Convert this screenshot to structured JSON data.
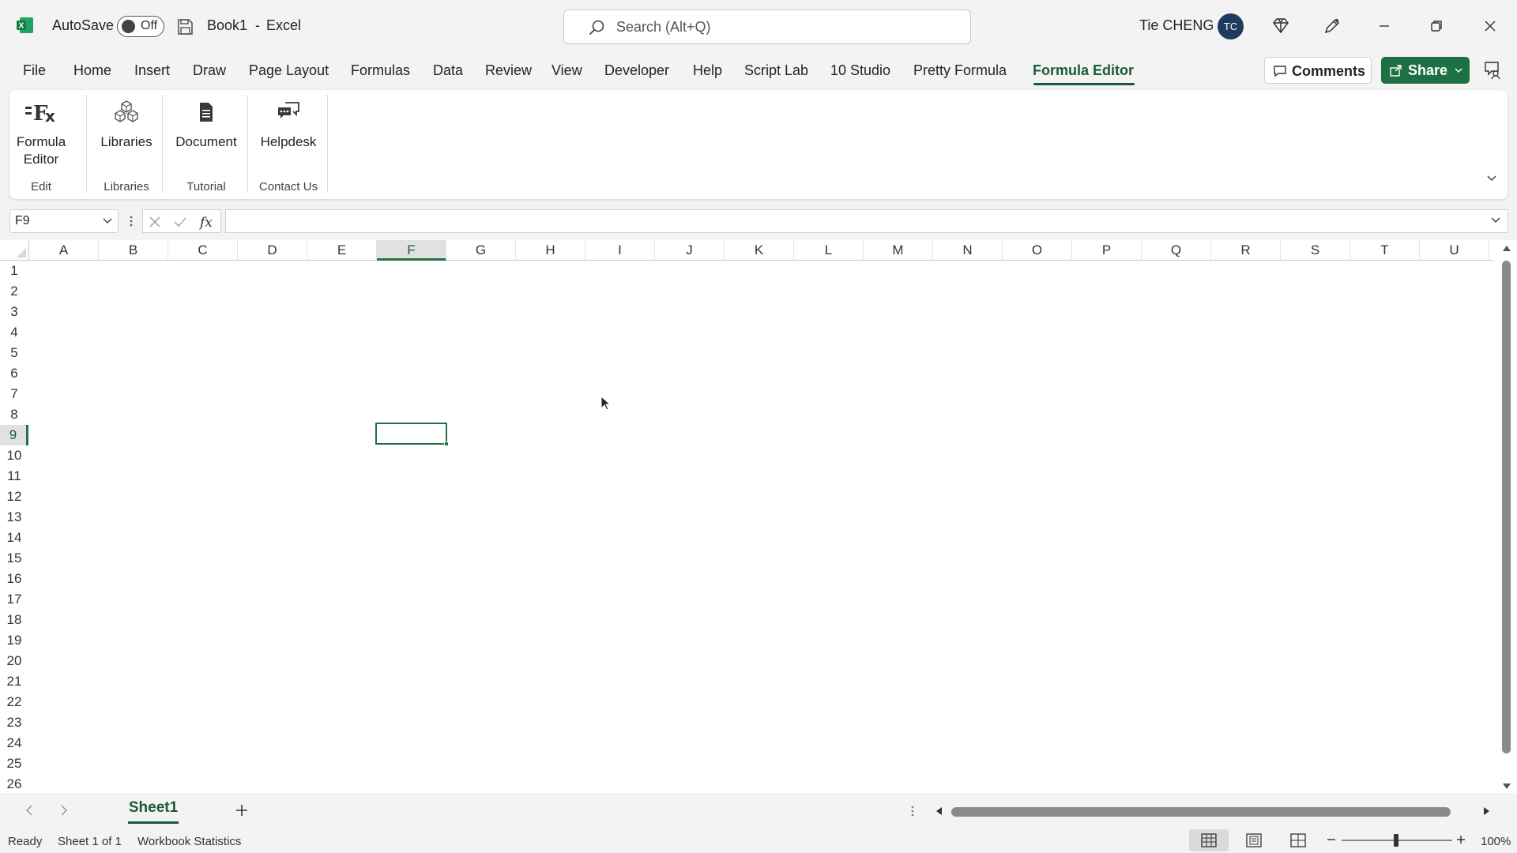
{
  "titlebar": {
    "autosave_label": "AutoSave",
    "autosave_state": "Off",
    "doc_title": "Book1",
    "separator": "-",
    "app_name": "Excel",
    "search_placeholder": "Search (Alt+Q)",
    "user_name": "Tie CHENG",
    "user_initials": "TC"
  },
  "menu": {
    "tabs": [
      "File",
      "Home",
      "Insert",
      "Draw",
      "Page Layout",
      "Formulas",
      "Data",
      "Review",
      "View",
      "Developer",
      "Help",
      "Script Lab",
      "10 Studio",
      "Pretty Formula",
      "Formula Editor"
    ],
    "active_tab": "Formula Editor",
    "comments_label": "Comments",
    "share_label": "Share"
  },
  "ribbon": {
    "buttons": [
      {
        "label_line1": "Formula",
        "label_line2": "Editor",
        "icon": "formula-fx-icon"
      },
      {
        "label_line1": "Libraries",
        "label_line2": "",
        "icon": "libraries-cubes-icon"
      },
      {
        "label_line1": "Document",
        "label_line2": "",
        "icon": "document-icon"
      },
      {
        "label_line1": "Helpdesk",
        "label_line2": "",
        "icon": "helpdesk-chat-icon"
      }
    ],
    "groups": [
      "Edit",
      "Libraries",
      "Tutorial",
      "Contact Us"
    ]
  },
  "formula_bar": {
    "name_box": "F9",
    "formula_value": ""
  },
  "grid": {
    "columns": [
      "A",
      "B",
      "C",
      "D",
      "E",
      "F",
      "G",
      "H",
      "I",
      "J",
      "K",
      "L",
      "M",
      "N",
      "O",
      "P",
      "Q",
      "R",
      "S",
      "T",
      "U"
    ],
    "rows": [
      "1",
      "2",
      "3",
      "4",
      "5",
      "6",
      "7",
      "8",
      "9",
      "10",
      "11",
      "12",
      "13",
      "14",
      "15",
      "16",
      "17",
      "18",
      "19",
      "20",
      "21",
      "22",
      "23",
      "24",
      "25",
      "26"
    ],
    "selected_column": "F",
    "selected_row": "9"
  },
  "sheets": {
    "tabs": [
      "Sheet1"
    ],
    "active": "Sheet1"
  },
  "status": {
    "mode": "Ready",
    "sheet_info": "Sheet 1 of 1",
    "workbook_stats": "Workbook Statistics",
    "zoom": "100%"
  },
  "colors": {
    "accent": "#185c37",
    "share_bg": "#1d7044",
    "selection": "#217346"
  }
}
